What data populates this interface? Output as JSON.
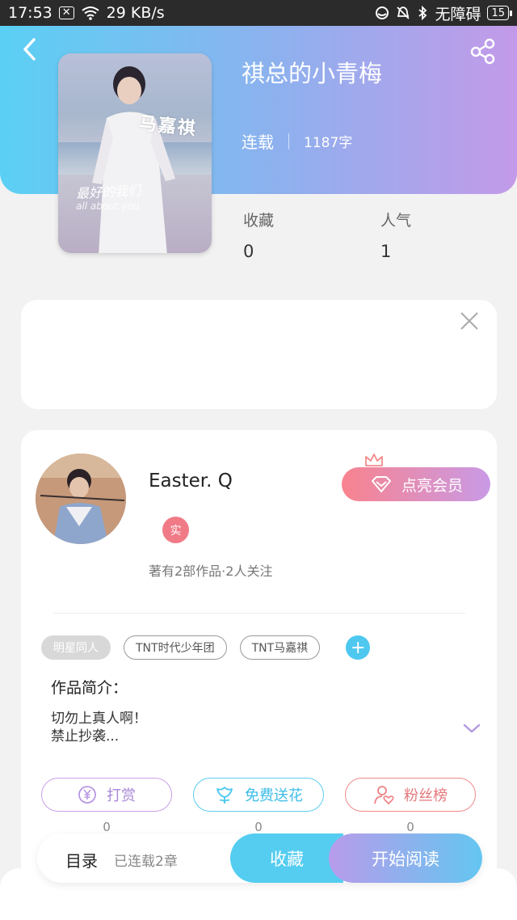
{
  "status_bar": {
    "time": "17:53",
    "speed": "29 KB/s",
    "carrier": "无障碍",
    "battery": "15"
  },
  "book": {
    "title": "祺总的小青梅",
    "status": "连载",
    "word_count": "1187字"
  },
  "cover_text": {
    "line1": "马嘉祺",
    "line2": "最好的我们",
    "line3": "all about you"
  },
  "stats": [
    {
      "label": "收藏",
      "value": "0"
    },
    {
      "label": "人气",
      "value": "1"
    }
  ],
  "author": {
    "name": "Easter. Q",
    "badge": "实",
    "summary": "著有2部作品·2人关注",
    "member_button": "点亮会员"
  },
  "tags": [
    "明星同人",
    "TNT时代少年团",
    "TNT马嘉祺"
  ],
  "intro": {
    "title": "作品简介：",
    "line1": "切勿上真人啊！",
    "line2": "禁止抄袭..."
  },
  "actions": [
    {
      "label": "打赏",
      "count": "0",
      "color": "#c8a0e8",
      "text_color": "#a887d8"
    },
    {
      "label": "免费送花",
      "count": "0",
      "color": "#5ccdf0",
      "text_color": "#3cbde8"
    },
    {
      "label": "粉丝榜",
      "count": "0",
      "color": "#f08a8a",
      "text_color": "#e6787c"
    }
  ],
  "bottom_bar": {
    "toc": "目录",
    "toc_sub": "已连载2章",
    "collect": "收藏",
    "read": "开始阅读"
  }
}
